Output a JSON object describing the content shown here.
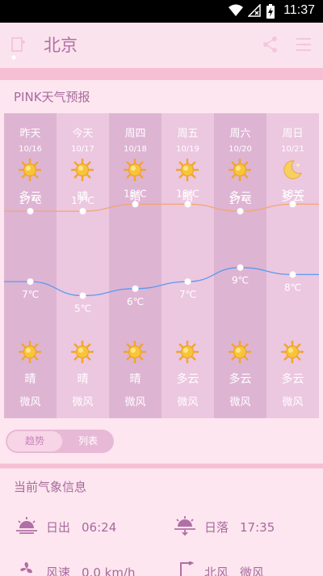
{
  "status": {
    "time": "11:37"
  },
  "header": {
    "city": "北京"
  },
  "forecast_title": "PINK天气预报",
  "days": [
    {
      "day": "昨天",
      "date": "10/16",
      "day_cond": "多云",
      "day_icon": "sun-icon",
      "night_cond": "晴",
      "night_icon": "sun-icon",
      "wind": "微风"
    },
    {
      "day": "今天",
      "date": "10/17",
      "day_cond": "晴",
      "day_icon": "sun-icon",
      "night_cond": "晴",
      "night_icon": "sun-icon",
      "wind": "微风"
    },
    {
      "day": "周四",
      "date": "10/18",
      "day_cond": "晴",
      "day_icon": "sun-icon",
      "night_cond": "晴",
      "night_icon": "sun-icon",
      "wind": "微风"
    },
    {
      "day": "周五",
      "date": "10/19",
      "day_cond": "晴",
      "day_icon": "sun-icon",
      "night_cond": "多云",
      "night_icon": "sun-icon",
      "wind": "微风"
    },
    {
      "day": "周六",
      "date": "10/20",
      "day_cond": "多云",
      "day_icon": "sun-icon",
      "night_cond": "多云",
      "night_icon": "sun-icon",
      "wind": "微风"
    },
    {
      "day": "周日",
      "date": "10/21",
      "day_cond": "多云",
      "day_icon": "moon-icon",
      "night_cond": "多云",
      "night_icon": "sun-icon",
      "wind": "微风"
    }
  ],
  "chart_data": {
    "type": "line",
    "categories": [
      "昨天",
      "今天",
      "周四",
      "周五",
      "周六",
      "周日"
    ],
    "series": [
      {
        "values": [
          17,
          17,
          18,
          18,
          17,
          18
        ],
        "labels": [
          "17℃",
          "17℃",
          "18℃",
          "18℃",
          "17℃",
          "18℃"
        ],
        "color": "#f3a66e"
      },
      {
        "values": [
          7,
          5,
          6,
          7,
          9,
          8
        ],
        "labels": [
          "7℃",
          "5℃",
          "6℃",
          "7℃",
          "9℃",
          "8℃"
        ],
        "color": "#5a9bef"
      }
    ]
  },
  "view_toggle": {
    "trend": "趋势",
    "list": "列表"
  },
  "current_title": "当前气象信息",
  "current": {
    "sunrise_label": "日出",
    "sunrise_value": "06:24",
    "sunset_label": "日落",
    "sunset_value": "17:35",
    "windspeed_label": "风速",
    "windspeed_value": "0.0 km/h",
    "winddir_label": "北风",
    "winddir_value": "微风"
  },
  "colors": {
    "accent": "#b06fa6",
    "pink_line": "#f7bfd4",
    "col_dark": "#deb4d3",
    "col_light": "#ecc7e0"
  }
}
